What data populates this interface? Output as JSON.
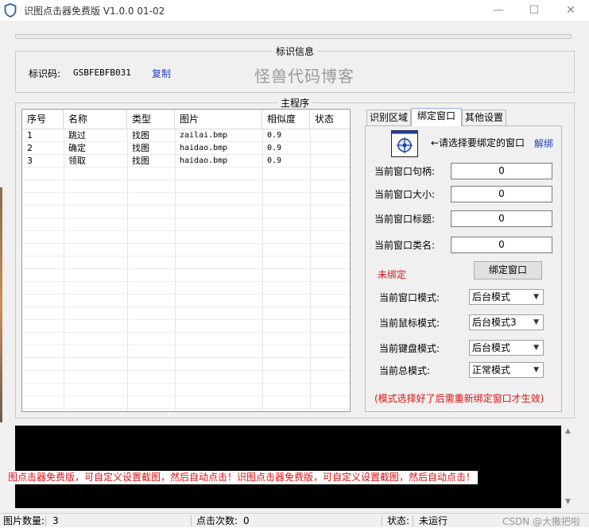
{
  "window": {
    "title": "识图点击器免费版 V1.0.0   01-02",
    "min_glyph": "—",
    "max_glyph": "☐",
    "close_glyph": "✕"
  },
  "id_section": {
    "legend": "标识信息",
    "label": "标识码:",
    "code": "GSBFEBFB031",
    "copy": "复制",
    "watermark": "怪兽代码博客"
  },
  "main": {
    "legend": "主程序",
    "columns": [
      "序号",
      "名称",
      "类型",
      "图片",
      "相似度",
      "状态"
    ],
    "rows": [
      {
        "no": "1",
        "name": "跳过",
        "type": "找图",
        "image": "zailai.bmp",
        "similarity": "0.9",
        "status": ""
      },
      {
        "no": "2",
        "name": "确定",
        "type": "找图",
        "image": "haidao.bmp",
        "similarity": "0.9",
        "status": ""
      },
      {
        "no": "3",
        "name": "领取",
        "type": "找图",
        "image": "haidao.bmp",
        "similarity": "0.9",
        "status": ""
      }
    ]
  },
  "tabs": {
    "items": [
      "识别区域",
      "绑定窗口",
      "其他设置"
    ],
    "active": "绑定窗口"
  },
  "bind": {
    "hint": "←请选择要绑定的窗口",
    "unbind": "解绑",
    "fields": [
      {
        "label": "当前窗口句柄:",
        "value": "0"
      },
      {
        "label": "当前窗口大小:",
        "value": "0"
      },
      {
        "label": "当前窗口标题:",
        "value": "0"
      },
      {
        "label": "当前窗口类名:",
        "value": "0"
      }
    ],
    "status": "未绑定",
    "bind_button": "绑定窗口",
    "modes": [
      {
        "label": "当前窗口模式:",
        "value": "后台模式"
      },
      {
        "label": "当前鼠标模式:",
        "value": "后台模式3"
      },
      {
        "label": "当前键盘模式:",
        "value": "后台模式"
      },
      {
        "label": "当前总模式:",
        "value": "正常模式"
      }
    ],
    "note": "(模式选择好了后需重新绑定窗口才生效)"
  },
  "console": {
    "marquee": "图点击器免费版，可自定义设置截图，然后自动点击！识图点击器免费版，可自定义设置截图，然后自动点击！"
  },
  "status": {
    "image_count_label": "图片数量:",
    "image_count": "3",
    "click_count_label": "点击次数:",
    "click_count": "0",
    "state_label": "状态:",
    "state": "未运行",
    "credit": "CSDN @大撒把啦"
  },
  "colors": {
    "link": "#1f3fbf",
    "alert": "#e01010",
    "console_bg": "#000000",
    "tab_highlight": "#9ab0d8"
  }
}
